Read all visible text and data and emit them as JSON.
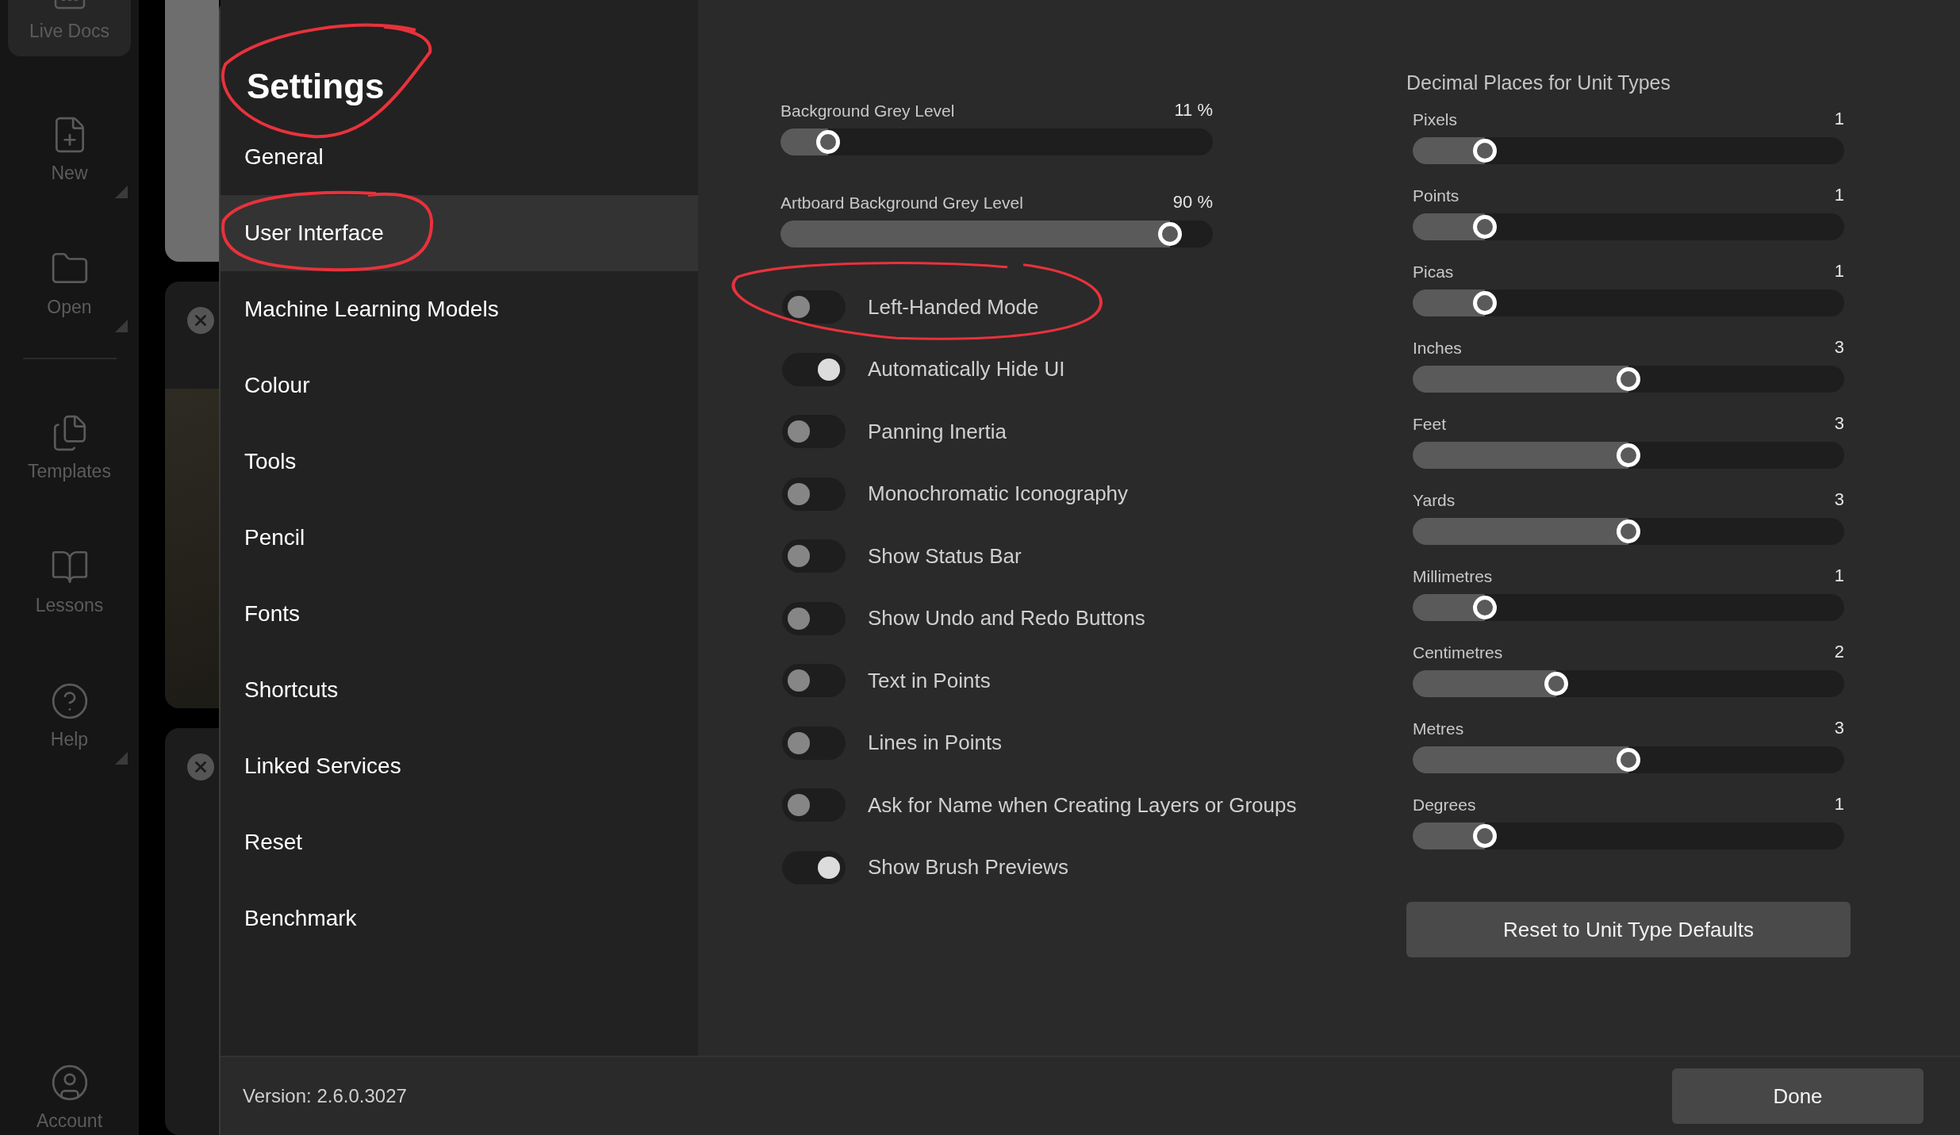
{
  "app_sidebar": {
    "top_items": [
      {
        "label": "Live Docs",
        "kind": "live",
        "menu": false,
        "selected": true
      },
      {
        "label": "New",
        "kind": "new",
        "menu": true,
        "selected": false
      },
      {
        "label": "Open",
        "kind": "open",
        "menu": true,
        "selected": false
      }
    ],
    "bottom_items": [
      {
        "label": "Templates",
        "kind": "templates",
        "menu": false,
        "selected": false
      },
      {
        "label": "Lessons",
        "kind": "lessons",
        "menu": false,
        "selected": false
      },
      {
        "label": "Help",
        "kind": "help",
        "menu": true,
        "selected": false
      }
    ],
    "account": {
      "label": "Account"
    }
  },
  "settings": {
    "title": "Settings",
    "nav": [
      {
        "label": "General",
        "selected": false
      },
      {
        "label": "User Interface",
        "selected": true
      },
      {
        "label": "Machine Learning Models",
        "selected": false
      },
      {
        "label": "Colour",
        "selected": false
      },
      {
        "label": "Tools",
        "selected": false
      },
      {
        "label": "Pencil",
        "selected": false
      },
      {
        "label": "Fonts",
        "selected": false
      },
      {
        "label": "Shortcuts",
        "selected": false
      },
      {
        "label": "Linked Services",
        "selected": false
      },
      {
        "label": "Reset",
        "selected": false
      },
      {
        "label": "Benchmark",
        "selected": false
      }
    ],
    "sliders": [
      {
        "label": "Background Grey Level",
        "value": "11 %",
        "level": 0.11
      },
      {
        "label": "Artboard Background Grey Level",
        "value": "90 %",
        "level": 0.9
      }
    ],
    "toggles": [
      {
        "label": "Left-Handed Mode",
        "on": false
      },
      {
        "label": "Automatically Hide UI",
        "on": true
      },
      {
        "label": "Panning Inertia",
        "on": false
      },
      {
        "label": "Monochromatic Iconography",
        "on": false
      },
      {
        "label": "Show Status Bar",
        "on": false
      },
      {
        "label": "Show Undo and Redo Buttons",
        "on": false
      },
      {
        "label": "Text in Points",
        "on": false
      },
      {
        "label": "Lines in Points",
        "on": false
      },
      {
        "label": "Ask for Name when Creating Layers or Groups",
        "on": false
      },
      {
        "label": "Show Brush Previews",
        "on": true
      }
    ],
    "units": {
      "title": "Decimal Places for Unit Types",
      "items": [
        {
          "label": "Pixels",
          "value": "1",
          "level": 0.167
        },
        {
          "label": "Points",
          "value": "1",
          "level": 0.167
        },
        {
          "label": "Picas",
          "value": "1",
          "level": 0.167
        },
        {
          "label": "Inches",
          "value": "3",
          "level": 0.5
        },
        {
          "label": "Feet",
          "value": "3",
          "level": 0.5
        },
        {
          "label": "Yards",
          "value": "3",
          "level": 0.5
        },
        {
          "label": "Millimetres",
          "value": "1",
          "level": 0.167
        },
        {
          "label": "Centimetres",
          "value": "2",
          "level": 0.333
        },
        {
          "label": "Metres",
          "value": "3",
          "level": 0.5
        },
        {
          "label": "Degrees",
          "value": "1",
          "level": 0.167
        }
      ],
      "reset_button": "Reset to Unit Type Defaults"
    },
    "footer": {
      "version": "Version: 2.6.0.3027",
      "done_button": "Done"
    }
  }
}
